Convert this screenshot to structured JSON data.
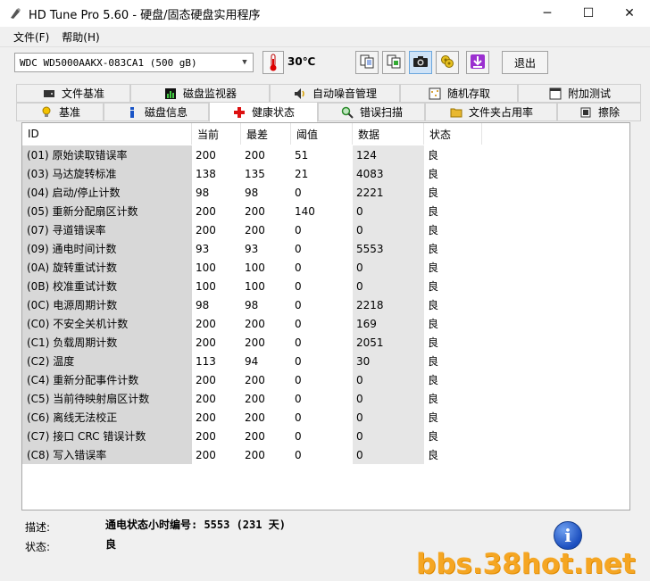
{
  "window": {
    "title": "HD Tune Pro 5.60 - 硬盘/固态硬盘实用程序",
    "minimize": "─",
    "maximize": "☐",
    "close": "✕"
  },
  "menu": [
    "文件(F)",
    "帮助(H)"
  ],
  "toolbar": {
    "drive": "WDC WD5000AAKX-083CA1 (500 gB)",
    "temperature": "30℃",
    "exit_label": "退出"
  },
  "tabs_top": [
    "文件基准",
    "磁盘监视器",
    "自动噪音管理",
    "随机存取",
    "附加测试"
  ],
  "tabs_bottom": [
    "基准",
    "磁盘信息",
    "健康状态",
    "错误扫描",
    "文件夹占用率",
    "擦除"
  ],
  "table": {
    "headers": [
      "ID",
      "当前",
      "最差",
      "阈值",
      "数据",
      "状态"
    ],
    "rows": [
      {
        "id": "(01) 原始读取错误率",
        "cur": "200",
        "worst": "200",
        "thr": "51",
        "data": "124",
        "status": "良"
      },
      {
        "id": "(03) 马达旋转标准",
        "cur": "138",
        "worst": "135",
        "thr": "21",
        "data": "4083",
        "status": "良"
      },
      {
        "id": "(04) 启动/停止计数",
        "cur": "98",
        "worst": "98",
        "thr": "0",
        "data": "2221",
        "status": "良"
      },
      {
        "id": "(05) 重新分配扇区计数",
        "cur": "200",
        "worst": "200",
        "thr": "140",
        "data": "0",
        "status": "良"
      },
      {
        "id": "(07) 寻道错误率",
        "cur": "200",
        "worst": "200",
        "thr": "0",
        "data": "0",
        "status": "良"
      },
      {
        "id": "(09) 通电时间计数",
        "cur": "93",
        "worst": "93",
        "thr": "0",
        "data": "5553",
        "status": "良"
      },
      {
        "id": "(0A) 旋转重试计数",
        "cur": "100",
        "worst": "100",
        "thr": "0",
        "data": "0",
        "status": "良"
      },
      {
        "id": "(0B) 校准重试计数",
        "cur": "100",
        "worst": "100",
        "thr": "0",
        "data": "0",
        "status": "良"
      },
      {
        "id": "(0C) 电源周期计数",
        "cur": "98",
        "worst": "98",
        "thr": "0",
        "data": "2218",
        "status": "良"
      },
      {
        "id": "(C0) 不安全关机计数",
        "cur": "200",
        "worst": "200",
        "thr": "0",
        "data": "169",
        "status": "良"
      },
      {
        "id": "(C1) 负载周期计数",
        "cur": "200",
        "worst": "200",
        "thr": "0",
        "data": "2051",
        "status": "良"
      },
      {
        "id": "(C2) 温度",
        "cur": "113",
        "worst": "94",
        "thr": "0",
        "data": "30",
        "status": "良"
      },
      {
        "id": "(C4) 重新分配事件计数",
        "cur": "200",
        "worst": "200",
        "thr": "0",
        "data": "0",
        "status": "良"
      },
      {
        "id": "(C5) 当前待映射扇区计数",
        "cur": "200",
        "worst": "200",
        "thr": "0",
        "data": "0",
        "status": "良"
      },
      {
        "id": "(C6) 离线无法校正",
        "cur": "200",
        "worst": "200",
        "thr": "0",
        "data": "0",
        "status": "良"
      },
      {
        "id": "(C7) 接口 CRC 错误计数",
        "cur": "200",
        "worst": "200",
        "thr": "0",
        "data": "0",
        "status": "良"
      },
      {
        "id": "(C8) 写入错误率",
        "cur": "200",
        "worst": "200",
        "thr": "0",
        "data": "0",
        "status": "良"
      }
    ]
  },
  "footer": {
    "desc_label": "描述:",
    "desc_value": "通电状态小时编号: 5553 (231 天)",
    "status_label": "状态:",
    "status_value": "良"
  },
  "watermark": "bbs.38hot.net"
}
